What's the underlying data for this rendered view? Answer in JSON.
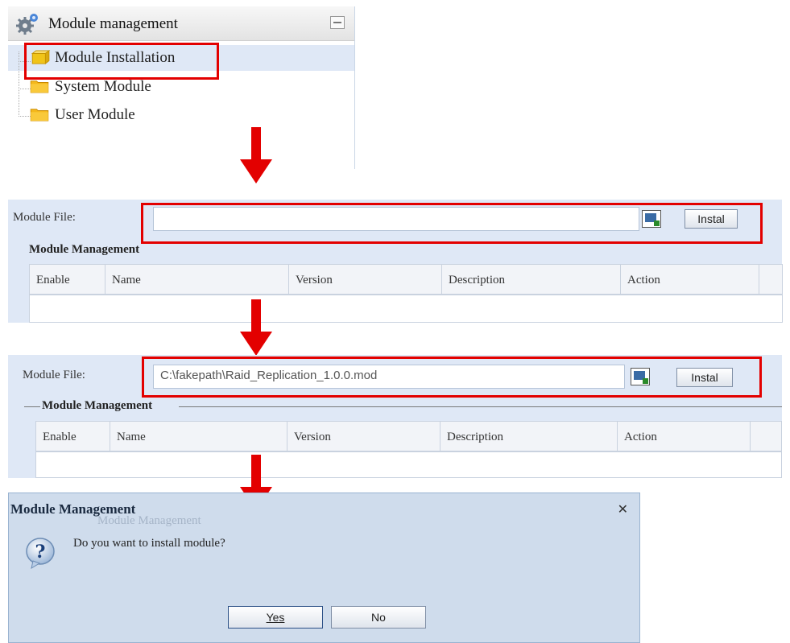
{
  "tree": {
    "title": "Module management",
    "items": [
      {
        "label": "Module Installation",
        "selected": true
      },
      {
        "label": "System Module",
        "selected": false
      },
      {
        "label": "User Module",
        "selected": false
      }
    ]
  },
  "panel2": {
    "file_label": "Module File:",
    "file_value": "",
    "install_label": "Instal",
    "section_title": "Module Management",
    "columns": [
      "Enable",
      "Name",
      "Version",
      "Description",
      "Action"
    ]
  },
  "panel3": {
    "file_label": "Module File:",
    "file_value": "C:\\fakepath\\Raid_Replication_1.0.0.mod",
    "install_label": "Instal",
    "section_title": "Module Management",
    "columns": [
      "Enable",
      "Name",
      "Version",
      "Description",
      "Action"
    ]
  },
  "dialog": {
    "title": "Module Management",
    "ghost_text": "Module Management",
    "message": "Do you want to install module?",
    "yes_label": "Yes",
    "no_label": "No",
    "close_icon": "close-icon",
    "question_icon": "question-icon"
  },
  "colors": {
    "highlight": "#e30000",
    "panel_bg": "#dfe8f6",
    "dialog_bg": "#cfdcec"
  }
}
